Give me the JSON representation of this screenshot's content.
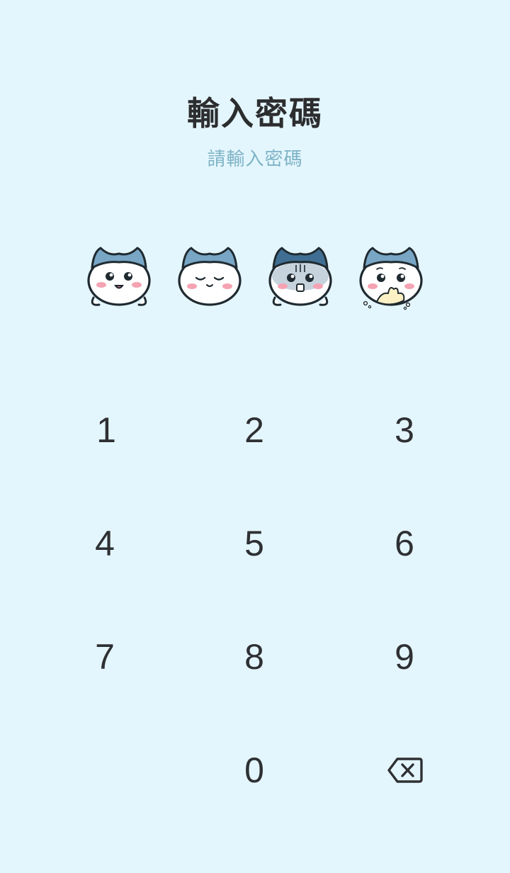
{
  "header": {
    "title": "輸入密碼",
    "subtitle": "請輸入密碼"
  },
  "pin_indicators": [
    {
      "icon": "cat-face-smiling-icon"
    },
    {
      "icon": "cat-face-content-icon"
    },
    {
      "icon": "cat-face-worried-icon"
    },
    {
      "icon": "cat-face-eating-icon"
    }
  ],
  "keypad": {
    "keys": [
      "1",
      "2",
      "3",
      "4",
      "5",
      "6",
      "7",
      "8",
      "9",
      "0"
    ],
    "backspace_icon": "backspace-icon"
  },
  "colors": {
    "background": "#e4f6fd",
    "title": "#2c2d2f",
    "subtitle": "#7eb3c6",
    "ear_blue": "#78a6c4",
    "ear_dark_blue": "#3f6e92",
    "blush": "#f5a3b3"
  }
}
